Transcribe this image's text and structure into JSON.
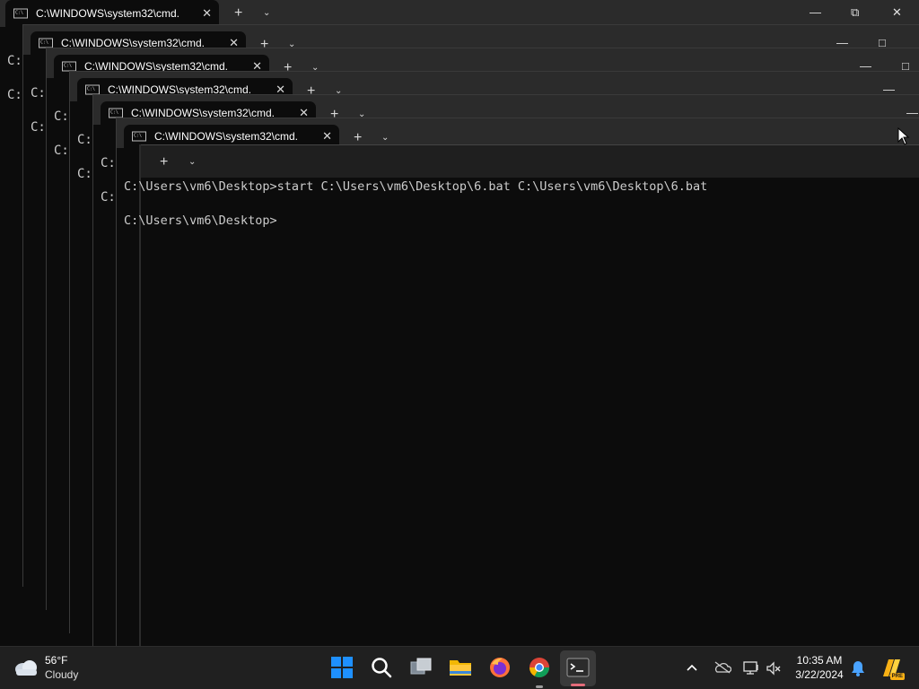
{
  "windows": [
    {
      "tab_title": "C:\\WINDOWS\\system32\\cmd.",
      "peek_lines": [
        "C:",
        "C:"
      ]
    },
    {
      "tab_title": "C:\\WINDOWS\\system32\\cmd.",
      "peek_lines": [
        "C:",
        "C:"
      ]
    },
    {
      "tab_title": "C:\\WINDOWS\\system32\\cmd.",
      "peek_lines": [
        "C:",
        "C:"
      ]
    },
    {
      "tab_title": "C:\\WINDOWS\\system32\\cmd.",
      "peek_lines": [
        "C:",
        "C:"
      ]
    },
    {
      "tab_title": "C:\\WINDOWS\\system32\\cmd.",
      "peek_lines": [
        "C:",
        "C:"
      ]
    },
    {
      "tab_title": "C:\\WINDOWS\\system32\\cmd."
    }
  ],
  "terminal": {
    "line1": "C:\\Users\\vm6\\Desktop>start C:\\Users\\vm6\\Desktop\\6.bat C:\\Users\\vm6\\Desktop\\6.bat",
    "line2": "C:\\Users\\vm6\\Desktop>"
  },
  "titlebar_buttons": {
    "new_tab": "+",
    "dropdown": "⌄",
    "minimize": "—",
    "maximize": "□",
    "restore": "⧉",
    "close": "✕"
  },
  "taskbar": {
    "weather": {
      "temp": "56°F",
      "condition": "Cloudy"
    },
    "clock": {
      "time": "10:35 AM",
      "date": "3/22/2024"
    },
    "apps": [
      "start-icon",
      "search-icon",
      "task-view-icon",
      "file-explorer-icon",
      "firefox-icon",
      "chrome-icon",
      "terminal-icon"
    ],
    "tray": [
      "chevron-up-icon",
      "onedrive-icon",
      "network-icon",
      "volume-muted-icon",
      "notification-bell-icon",
      "copilot-icon"
    ],
    "copilot_badge": "PRE"
  },
  "colors": {
    "terminal_bg": "#0c0c0c",
    "titlebar_bg": "#2b2b2b",
    "taskbar_bg": "#202020",
    "accent": "#0078d4"
  }
}
